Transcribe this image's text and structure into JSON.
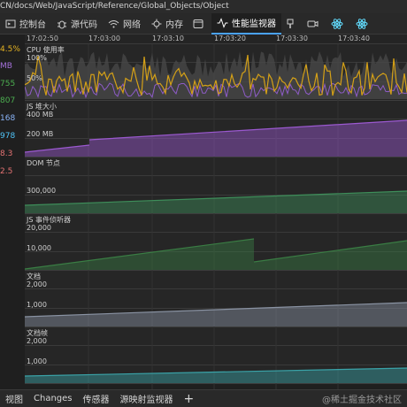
{
  "url_bar": {
    "text": "CN/docs/Web/JavaScript/Reference/Global_Objects/Object"
  },
  "tabs": [
    {
      "label": "控制台",
      "icon": "console-icon"
    },
    {
      "label": "源代码",
      "icon": "bug-icon"
    },
    {
      "label": "网络",
      "icon": "wifi-icon"
    },
    {
      "label": "内存",
      "icon": "gear-icon"
    },
    {
      "label": "",
      "icon": "window-icon"
    },
    {
      "label": "性能监视器",
      "icon": "pulse-icon",
      "active": true
    },
    {
      "label": "",
      "icon": "brush-icon"
    },
    {
      "label": "",
      "icon": "video-icon"
    },
    {
      "label": "",
      "icon": "react-icon"
    },
    {
      "label": "",
      "icon": "react-icon"
    }
  ],
  "left_values": [
    {
      "text": "4.5%",
      "color": "#e6b422"
    },
    {
      "text": "MB",
      "color": "#a370d8"
    },
    {
      "text": "755",
      "color": "#4caf50"
    },
    {
      "text": "807",
      "color": "#4caf50"
    },
    {
      "text": "168",
      "color": "#8ab4f8"
    },
    {
      "text": "978",
      "color": "#4fc3f7"
    },
    {
      "text": "8.3",
      "color": "#e57373"
    },
    {
      "text": "2.5",
      "color": "#e57373"
    }
  ],
  "timeline": {
    "ticks": [
      "17:02:50",
      "17:03:00",
      "17:03:10",
      "17:03:20",
      "17:03:30",
      "17:03:40"
    ]
  },
  "panels": {
    "cpu": {
      "title": "CPU 使用率",
      "labels": [
        "100%",
        "50%"
      ]
    },
    "js_heap": {
      "title": "JS 堆大小",
      "labels": [
        "400 MB",
        "200 MB"
      ]
    },
    "dom_nodes": {
      "title": "DOM 节点",
      "labels": [
        "300,000"
      ]
    },
    "js_listeners": {
      "title": "JS 事件侦听器",
      "labels": [
        "20,000",
        "10,000"
      ]
    },
    "documents": {
      "title": "文档",
      "labels": [
        "2,000",
        "1,000"
      ]
    },
    "frames": {
      "title": "文档帧",
      "labels": [
        "2,000",
        "1,000"
      ]
    }
  },
  "drawer": {
    "tabs": [
      "视图",
      "Changes",
      "传感器",
      "源映射监视器"
    ],
    "add": "+"
  },
  "watermark": "@稀土掘金技术社区",
  "colors": {
    "cpu_yellow": "#d4a017",
    "cpu_purple": "#8e5cc8",
    "heap": "#9b59d0",
    "dom": "#3e8e5a",
    "listeners": "#3a7d44",
    "documents": "#8a93a3",
    "frames": "#3aa3a8"
  }
}
